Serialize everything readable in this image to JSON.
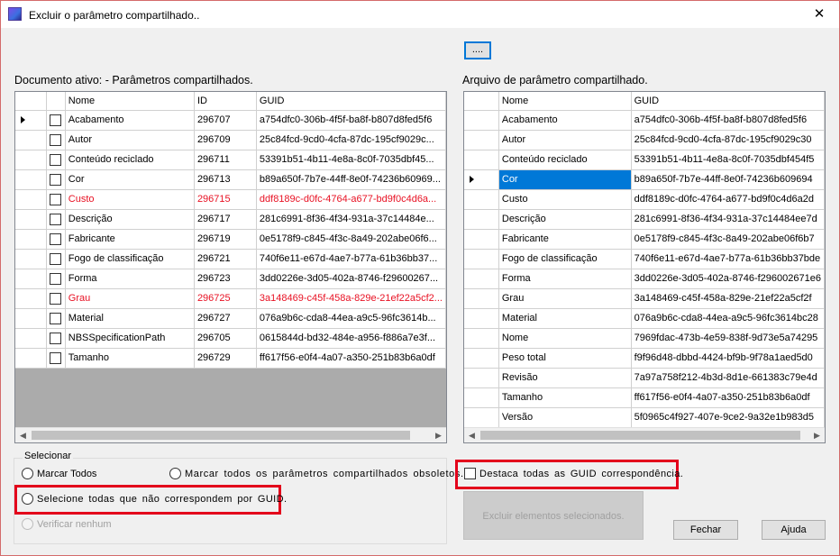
{
  "window": {
    "title": "Excluir o parâmetro compartilhado..",
    "close_glyph": "✕"
  },
  "browse_button": {
    "label": "...."
  },
  "left_panel": {
    "label": "Documento ativo: - Parâmetros compartilhados.",
    "columns": [
      "Nome",
      "ID",
      "GUID"
    ],
    "rows": [
      {
        "name": "Acabamento",
        "id": "296707",
        "guid": "a754dfc0-306b-4f5f-ba8f-b807d8fed5f6",
        "red": false,
        "current": true
      },
      {
        "name": "Autor",
        "id": "296709",
        "guid": "25c84fcd-9cd0-4cfa-87dc-195cf9029c...",
        "red": false,
        "current": false
      },
      {
        "name": "Conteúdo reciclado",
        "id": "296711",
        "guid": "53391b51-4b11-4e8a-8c0f-7035dbf45...",
        "red": false,
        "current": false
      },
      {
        "name": "Cor",
        "id": "296713",
        "guid": "b89a650f-7b7e-44ff-8e0f-74236b60969...",
        "red": false,
        "current": false
      },
      {
        "name": "Custo",
        "id": "296715",
        "guid": "ddf8189c-d0fc-4764-a677-bd9f0c4d6a...",
        "red": true,
        "current": false
      },
      {
        "name": "Descrição",
        "id": "296717",
        "guid": "281c6991-8f36-4f34-931a-37c14484e...",
        "red": false,
        "current": false
      },
      {
        "name": "Fabricante",
        "id": "296719",
        "guid": "0e5178f9-c845-4f3c-8a49-202abe06f6...",
        "red": false,
        "current": false
      },
      {
        "name": "Fogo de classificação",
        "id": "296721",
        "guid": "740f6e11-e67d-4ae7-b77a-61b36bb37...",
        "red": false,
        "current": false
      },
      {
        "name": "Forma",
        "id": "296723",
        "guid": "3dd0226e-3d05-402a-8746-f29600267...",
        "red": false,
        "current": false
      },
      {
        "name": "Grau",
        "id": "296725",
        "guid": "3a148469-c45f-458a-829e-21ef22a5cf2...",
        "red": true,
        "current": false
      },
      {
        "name": "Material",
        "id": "296727",
        "guid": "076a9b6c-cda8-44ea-a9c5-96fc3614b...",
        "red": false,
        "current": false
      },
      {
        "name": "NBSSpecificationPath",
        "id": "296705",
        "guid": "0615844d-bd32-484e-a956-f886a7e3f...",
        "red": false,
        "current": false
      },
      {
        "name": "Tamanho",
        "id": "296729",
        "guid": "ff617f56-e0f4-4a07-a350-251b83b6a0df",
        "red": false,
        "current": false
      }
    ]
  },
  "right_panel": {
    "label": "Arquivo de parâmetro compartilhado.",
    "columns": [
      "Nome",
      "GUID"
    ],
    "rows": [
      {
        "name": "Acabamento",
        "guid": "a754dfc0-306b-4f5f-ba8f-b807d8fed5f6",
        "selected": false
      },
      {
        "name": "Autor",
        "guid": "25c84fcd-9cd0-4cfa-87dc-195cf9029c30",
        "selected": false
      },
      {
        "name": "Conteúdo reciclado",
        "guid": "53391b51-4b11-4e8a-8c0f-7035dbf454f5",
        "selected": false
      },
      {
        "name": "Cor",
        "guid": "b89a650f-7b7e-44ff-8e0f-74236b609694",
        "selected": true
      },
      {
        "name": "Custo",
        "guid": "ddf8189c-d0fc-4764-a677-bd9f0c4d6a2d",
        "selected": false
      },
      {
        "name": "Descrição",
        "guid": "281c6991-8f36-4f34-931a-37c14484ee7d",
        "selected": false
      },
      {
        "name": "Fabricante",
        "guid": "0e5178f9-c845-4f3c-8a49-202abe06f6b7",
        "selected": false
      },
      {
        "name": "Fogo de classificação",
        "guid": "740f6e11-e67d-4ae7-b77a-61b36bb37bde",
        "selected": false
      },
      {
        "name": "Forma",
        "guid": "3dd0226e-3d05-402a-8746-f296002671e6",
        "selected": false
      },
      {
        "name": "Grau",
        "guid": "3a148469-c45f-458a-829e-21ef22a5cf2f",
        "selected": false
      },
      {
        "name": "Material",
        "guid": "076a9b6c-cda8-44ea-a9c5-96fc3614bc28",
        "selected": false
      },
      {
        "name": "Nome",
        "guid": "7969fdac-473b-4e59-838f-9d73e5a74295",
        "selected": false
      },
      {
        "name": "Peso total",
        "guid": "f9f96d48-dbbd-4424-bf9b-9f78a1aed5d0",
        "selected": false
      },
      {
        "name": "Revisão",
        "guid": "7a97a758f212-4b3d-8d1e-661383c79e4d",
        "selected": false
      },
      {
        "name": "Tamanho",
        "guid": "ff617f56-e0f4-4a07-a350-251b83b6a0df",
        "selected": false
      },
      {
        "name": "Versão",
        "guid": "5f0965c4f927-407e-9ce2-9a32e1b983d5",
        "selected": false
      }
    ]
  },
  "select_group": {
    "title": "Selecionar",
    "mark_all": "Marcar Todos",
    "mark_obsolete": "Marcar todos os parâmetros compartilhados obsoletos.",
    "select_unmatched": "Selecione todas que não correspondem por GUID.",
    "check_none": "Verificar nenhum"
  },
  "highlight_checkbox": {
    "label": "Destaca todas as GUID correspondência."
  },
  "buttons": {
    "delete_selected": "Excluir elementos selecionados.",
    "close": "Fechar",
    "help": "Ajuda"
  },
  "colors": {
    "mismatch_red": "#e81123",
    "selection_blue": "#0078d7",
    "annotation_red": "#e3001b"
  },
  "icons": {
    "scroll_left": "◀",
    "scroll_right": "▶"
  }
}
